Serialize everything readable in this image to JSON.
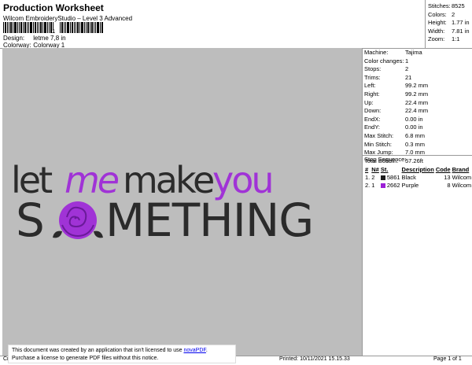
{
  "header": {
    "title": "Production Worksheet",
    "subtitle": "Wilcom EmbroideryStudio – Level 3 Advanced",
    "barcode_number": "1",
    "design_label": "Design:",
    "design_value": "letme 7,8 in",
    "colorway_label": "Colorway:",
    "colorway_value": "Colorway 1"
  },
  "stats": [
    {
      "label": "Stitches:",
      "value": "8525"
    },
    {
      "label": "Colors:",
      "value": "2"
    },
    {
      "label": "Height:",
      "value": "1.77 in"
    },
    {
      "label": "Width:",
      "value": "7.81 in"
    },
    {
      "label": "Zoom:",
      "value": "1:1"
    }
  ],
  "machine": [
    {
      "label": "Machine:",
      "value": "Tajima"
    },
    {
      "label": "Color changes:",
      "value": "1"
    },
    {
      "label": "Stops:",
      "value": "2"
    },
    {
      "label": "Trims:",
      "value": "21"
    },
    {
      "label": "Left:",
      "value": "99.2 mm"
    },
    {
      "label": "Right:",
      "value": "99.2 mm"
    },
    {
      "label": "Up:",
      "value": "22.4 mm"
    },
    {
      "label": "Down:",
      "value": "22.4 mm"
    },
    {
      "label": "EndX:",
      "value": "0.00 in"
    },
    {
      "label": "EndY:",
      "value": "0.00 in"
    },
    {
      "label": "Max Stitch:",
      "value": "6.8 mm"
    },
    {
      "label": "Min Stitch:",
      "value": "0.3 mm"
    },
    {
      "label": "Max Jump:",
      "value": "7.0 mm"
    },
    {
      "label": "Total Bobbin:",
      "value": "57.26ft"
    }
  ],
  "stop_sequence": {
    "title": "Stop Sequence:",
    "headers": [
      "#",
      "N#",
      "St.",
      "Description",
      "Code",
      "Brand"
    ],
    "rows": [
      {
        "index": "1.",
        "n": "2",
        "color": "#1a1a1a",
        "st": "5861",
        "description": "Black",
        "code": "13",
        "brand": "Wilcom"
      },
      {
        "index": "2.",
        "n": "1",
        "color": "#9b1fd6",
        "st": "2662",
        "description": "Purple",
        "code": "8",
        "brand": "Wilcom"
      }
    ]
  },
  "design": {
    "line1_a": "let",
    "line1_b": "me",
    "line1_c": "make",
    "line1_d": "you",
    "line2_a": "S",
    "line2_b": "METHING",
    "colors": {
      "black": "#2b2b2b",
      "purple": "#a033d6",
      "background": "#bdbdbd"
    }
  },
  "notice": {
    "line1_prefix": "This document was created by an application that isn't licensed to use ",
    "link": "novaPDF",
    "line1_suffix": ".",
    "line2": "Purchase a license to generate PDF files without this notice."
  },
  "footer": {
    "left": "Cr",
    "printed": "Printed: 10/11/2021 15.15.33",
    "page": "Page 1 of 1"
  }
}
